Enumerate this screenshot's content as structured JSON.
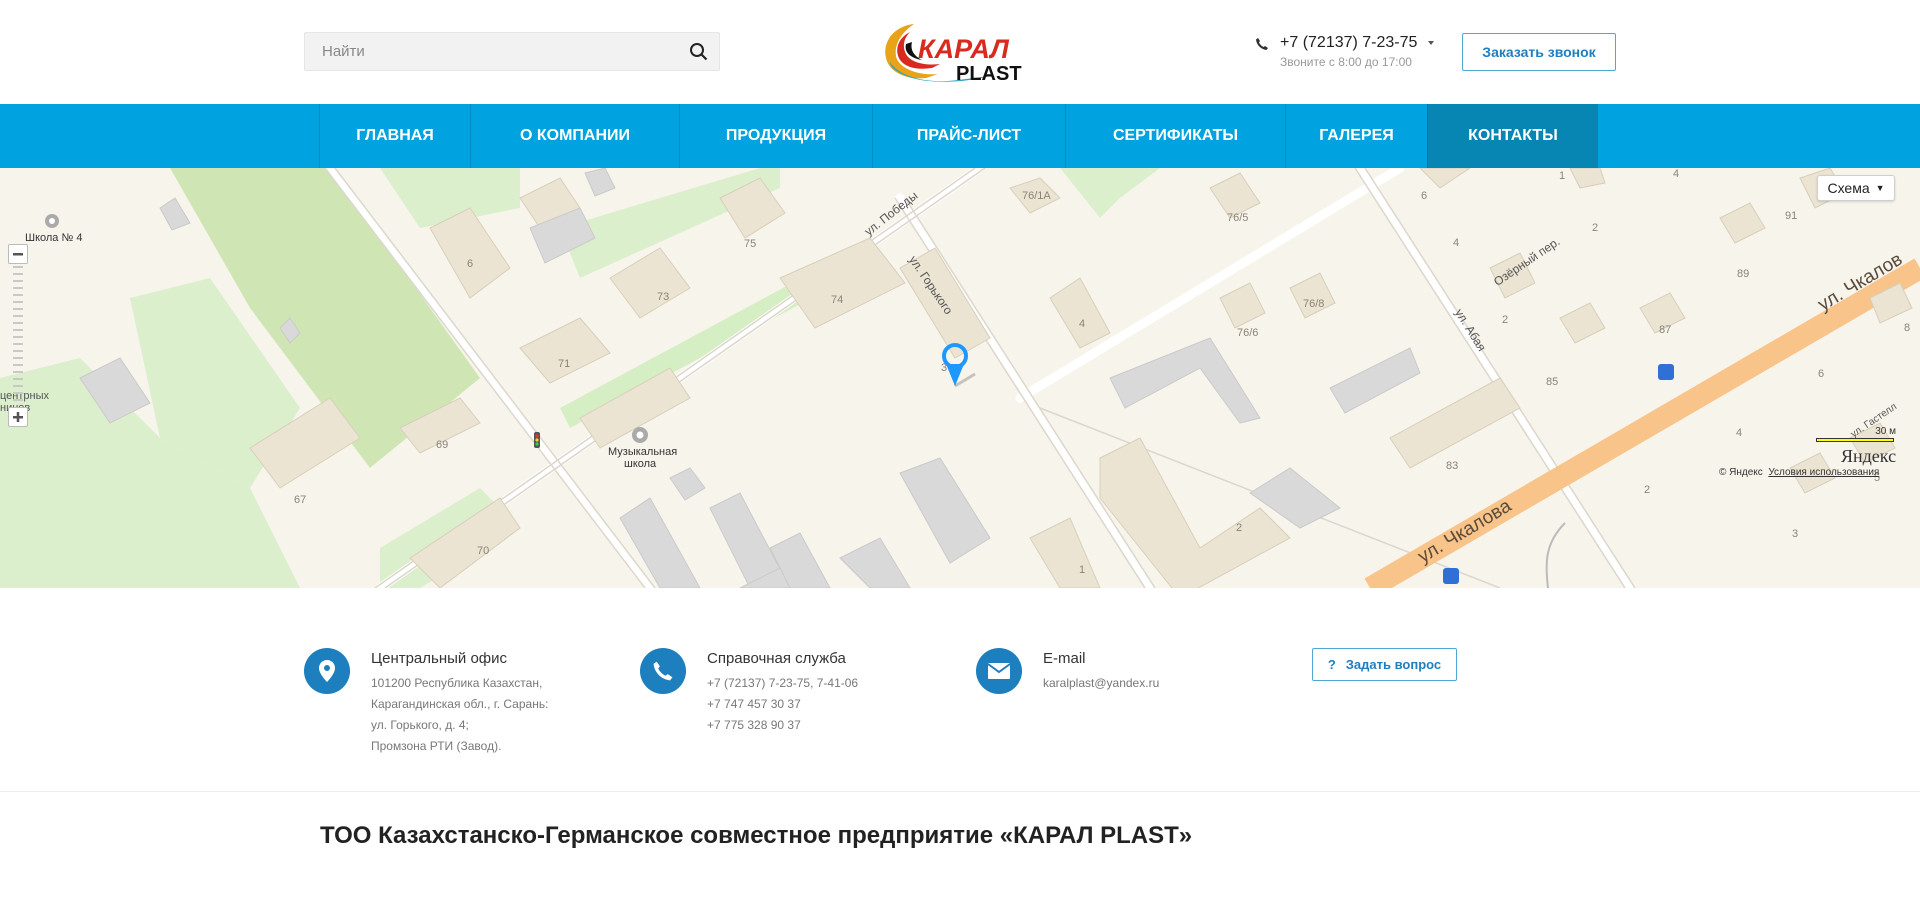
{
  "header": {
    "search_placeholder": "Найти",
    "logo": {
      "line1": "КАРАЛ",
      "line2": "PLAST"
    },
    "phone": "+7 (72137) 7-23-75",
    "hours": "Звоните с 8:00 до 17:00",
    "callback_label": "Заказать звонок"
  },
  "nav": {
    "items": [
      {
        "label": "ГЛАВНАЯ"
      },
      {
        "label": "О КОМПАНИИ"
      },
      {
        "label": "ПРОДУКЦИЯ"
      },
      {
        "label": "ПРАЙС-ЛИСТ"
      },
      {
        "label": "СЕРТИФИКАТЫ"
      },
      {
        "label": "ГАЛЕРЕЯ"
      },
      {
        "label": "КОНТАКТЫ"
      }
    ],
    "active": "КОНТАКТЫ"
  },
  "map": {
    "layer_button": "Схема",
    "streets": {
      "pobedy": "ул. Победы",
      "gorkogo": "ул. Горького",
      "ozerny": "Озёрный пер.",
      "abaya": "ул. Абая",
      "chkalova": "ул. Чкалова",
      "chkalova_top": "ул. Чкалов",
      "gastello": "ул. Гастелл"
    },
    "pois": {
      "school": "Школа № 4",
      "music_school_1": "Музыкальная",
      "music_school_2": "школа",
      "cut_label_1": "центрных",
      "cut_label_2": "нинов"
    },
    "house_numbers": {
      "h76_1a": "76/1А",
      "h76_5": "76/5",
      "h76_6": "76/6",
      "h76_8": "76/8",
      "h75": "75",
      "h74": "74",
      "h73": "73",
      "h71": "71",
      "h69": "69",
      "h67": "67",
      "h70": "70",
      "h6": "6",
      "h4": "4",
      "h3": "3",
      "h2": "2",
      "h1": "1",
      "h1b": "1",
      "h83": "83",
      "h85": "85",
      "h87": "87",
      "h89": "89",
      "h91": "91",
      "h6b": "6",
      "h4b": "4",
      "h2b": "2",
      "h2c": "2",
      "h2d": "2",
      "h3b": "3",
      "h4c": "4",
      "h4d": "4",
      "h5": "5",
      "h6c": "6",
      "h8": "8",
      "h6d": "6"
    },
    "scale_label": "30 м",
    "brand": "Яндекс",
    "copyright": "© Яндекс",
    "terms": "Условия использования"
  },
  "contacts": [
    {
      "title": "Центральный офис",
      "lines": [
        "101200 Республика Казахстан,",
        "Карагандинская обл., г. Сарань:",
        "ул. Горького, д. 4;",
        "Промзона РТИ (Завод)."
      ]
    },
    {
      "title": "Справочная служба",
      "lines": [
        "+7 (72137) 7-23-75, 7-41-06",
        "+7 747 457 30 37",
        "+7 775 328 90 37"
      ]
    },
    {
      "title": "E-mail",
      "lines": [
        "karalplast@yandex.ru"
      ]
    }
  ],
  "ask_button": "Задать вопрос",
  "ask_icon": "?",
  "page_title": "ТОО Казахстанско-Германское совместное предприятие «КАРАЛ PLAST»",
  "colors": {
    "nav": "#00a3e0",
    "nav_active": "#0786b4",
    "accent": "#1e7fbf"
  }
}
